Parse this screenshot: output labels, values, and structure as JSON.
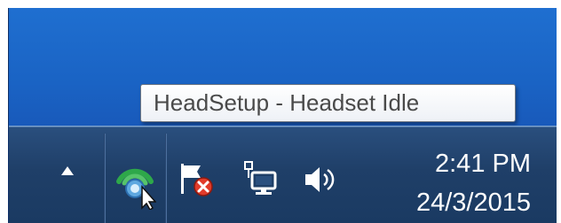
{
  "tooltip": {
    "text": "HeadSetup - Headset Idle"
  },
  "tray": {
    "icons": [
      {
        "name": "show-hidden-icons-arrow-icon"
      },
      {
        "name": "headsetup-icon"
      },
      {
        "name": "action-center-flag-icon"
      },
      {
        "name": "network-icon"
      },
      {
        "name": "volume-icon"
      }
    ],
    "colors": {
      "taskbar": "#1f3f68",
      "desktop": "#1a63c4",
      "headset_green": "#2ea84a",
      "flag_error": "#e23b2a"
    }
  },
  "clock": {
    "time": "2:41 PM",
    "date": "24/3/2015"
  }
}
